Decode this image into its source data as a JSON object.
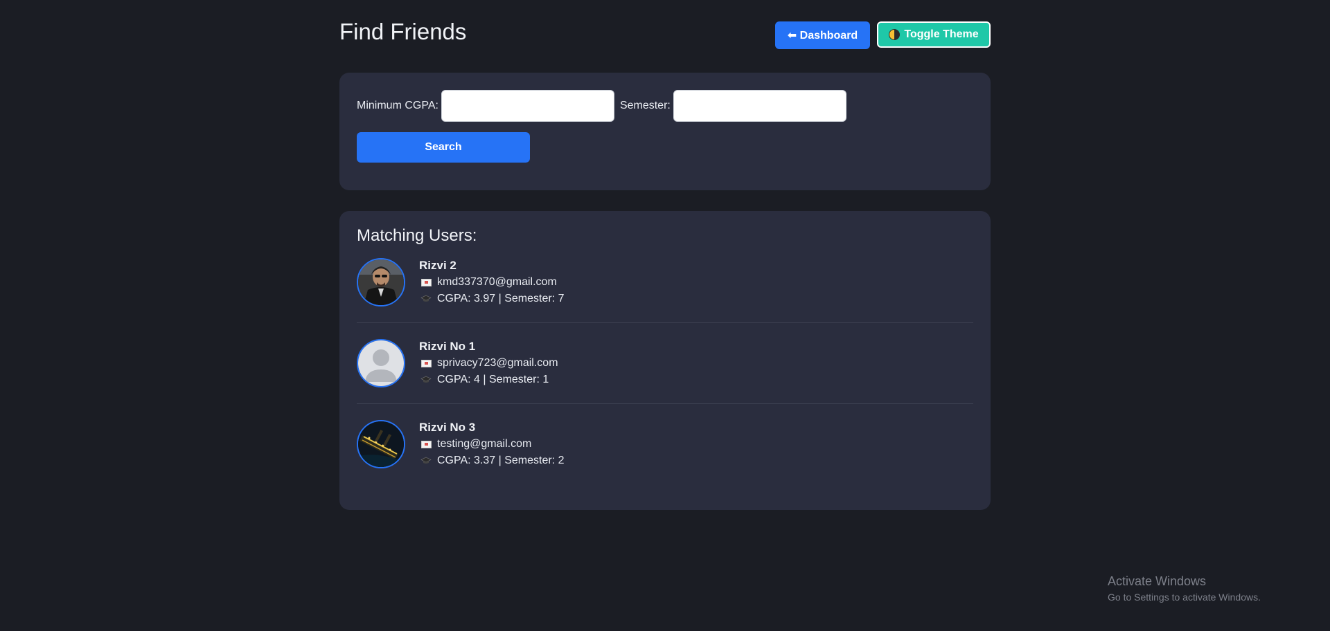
{
  "page": {
    "title": "Find Friends"
  },
  "header": {
    "dashboard_label": "⬅ Dashboard",
    "theme_label": "Toggle Theme"
  },
  "search": {
    "cgpa_label": "Minimum CGPA:",
    "cgpa_value": "",
    "semester_label": "Semester:",
    "semester_value": "",
    "search_label": "Search"
  },
  "results": {
    "title": "Matching Users:",
    "users": [
      {
        "name": "Rizvi 2",
        "email": "kmd337370@gmail.com",
        "details": "CGPA: 3.97 | Semester: 7",
        "avatar": "photo-portrait"
      },
      {
        "name": "Rizvi No 1",
        "email": "sprivacy723@gmail.com",
        "details": "CGPA: 4 | Semester: 1",
        "avatar": "default-avatar"
      },
      {
        "name": "Rizvi No 3",
        "email": "testing@gmail.com",
        "details": "CGPA: 3.37 | Semester: 2",
        "avatar": "photo-ship-night"
      }
    ]
  },
  "watermark": {
    "title": "Activate Windows",
    "subtitle": "Go to Settings to activate Windows."
  },
  "colors": {
    "background": "#1b1d24",
    "card": "#2a2d3e",
    "primary": "#2673f6",
    "theme_button": "#1fc8a8"
  }
}
